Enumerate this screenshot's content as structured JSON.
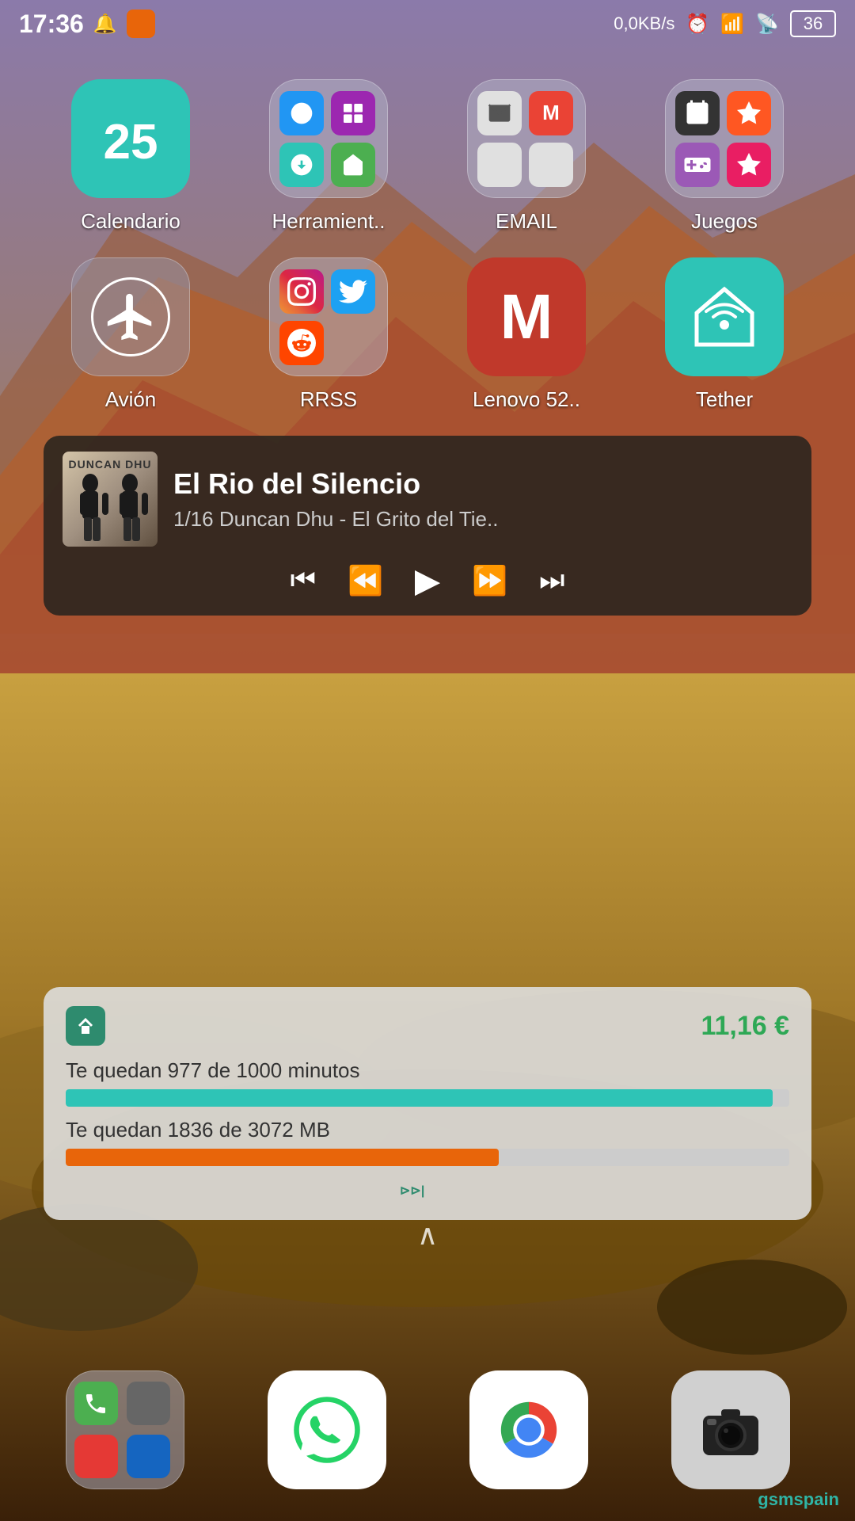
{
  "statusBar": {
    "time": "17:36",
    "network": "0,0KB/s",
    "battery": "36"
  },
  "apps": [
    {
      "id": "calendario",
      "label": "Calendario",
      "type": "calendar",
      "day": "25"
    },
    {
      "id": "herramientas",
      "label": "Herramient..",
      "type": "folder"
    },
    {
      "id": "email",
      "label": "EMAIL",
      "type": "email_folder"
    },
    {
      "id": "juegos",
      "label": "Juegos",
      "type": "games_folder"
    },
    {
      "id": "avion",
      "label": "Avión",
      "type": "avion"
    },
    {
      "id": "rrss",
      "label": "RRSS",
      "type": "rrss_folder"
    },
    {
      "id": "lenovo",
      "label": "Lenovo 52..",
      "type": "m_app"
    },
    {
      "id": "tether",
      "label": "Tether",
      "type": "tether"
    }
  ],
  "musicPlayer": {
    "songTitle": "El Rio del Silencio",
    "trackInfo": "1/16 Duncan Dhu - El Grito del Tie..",
    "albumArtist": "DUNCAN DHU"
  },
  "widget": {
    "price": "11,16 €",
    "minutesText": "Te quedan 977 de 1000 minutos",
    "minutesFill": 97.7,
    "mbText": "Te quedan 1836 de 3072 MB",
    "mbFill": 59.8,
    "brand": "gsmspain"
  },
  "dock": [
    {
      "id": "phone-folder",
      "type": "phone_folder"
    },
    {
      "id": "whatsapp",
      "type": "whatsapp"
    },
    {
      "id": "chrome",
      "type": "chrome"
    },
    {
      "id": "camera",
      "type": "camera"
    }
  ],
  "controls": {
    "skipBack2": "⏮",
    "skipBack": "⏪",
    "play": "▶",
    "skipFwd": "⏩",
    "skipFwd2": "⏭"
  }
}
